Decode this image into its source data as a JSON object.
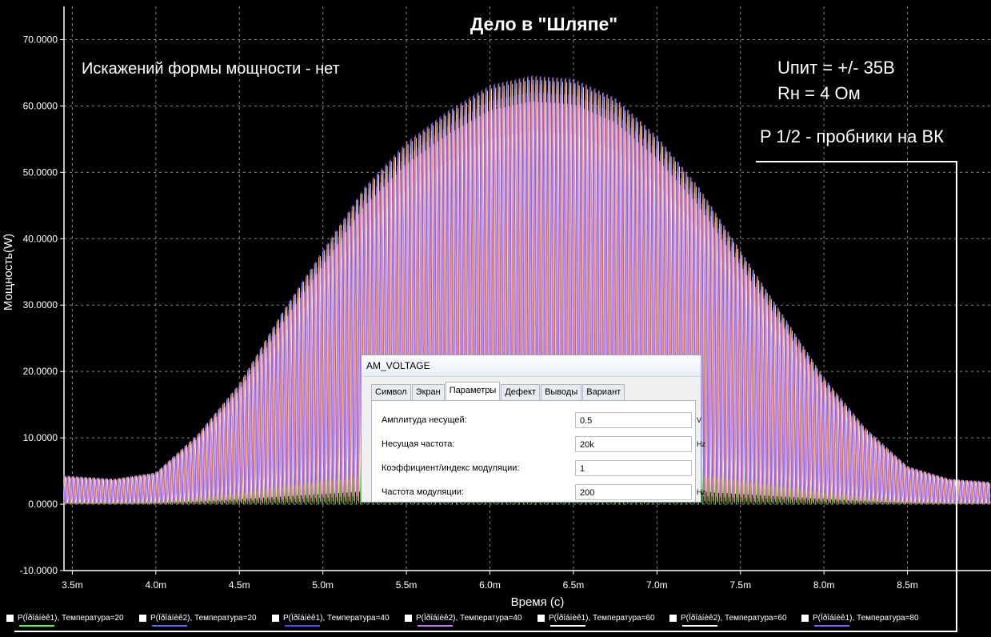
{
  "chart_data": {
    "type": "line",
    "title": "Дело  в  \"Шляпе\"",
    "xlabel": "Время (с)",
    "ylabel": "Мощность(W)",
    "x_unit": "ms",
    "xlim": [
      3.45,
      9.0
    ],
    "ylim": [
      -10,
      75
    ],
    "x_ticks": [
      3.5,
      4.0,
      4.5,
      5.0,
      5.5,
      6.0,
      6.5,
      7.0,
      7.5,
      8.0,
      8.5
    ],
    "x_tick_labels": [
      "3.5m",
      "4.0m",
      "4.5m",
      "5.0m",
      "5.5m",
      "6.0m",
      "6.5m",
      "7.0m",
      "7.5m",
      "8.0m",
      "8.5m"
    ],
    "y_ticks": [
      -10,
      0,
      10,
      20,
      30,
      40,
      50,
      60,
      70
    ],
    "y_tick_labels": [
      "-10.0000",
      "0.0000",
      "10.0000",
      "20.0000",
      "30.0000",
      "40.0000",
      "50.0000",
      "60.0000",
      "70.0000"
    ],
    "grid": true,
    "envelope": {
      "x": [
        3.45,
        3.75,
        4.0,
        4.25,
        4.5,
        4.75,
        5.0,
        5.25,
        5.5,
        5.75,
        6.0,
        6.25,
        6.5,
        6.75,
        7.0,
        7.25,
        7.5,
        7.75,
        8.0,
        8.25,
        8.5,
        8.75,
        9.0
      ],
      "y": [
        4.5,
        4.0,
        5.0,
        11.0,
        19.0,
        30.0,
        40.0,
        50.0,
        57.0,
        62.0,
        66.0,
        67.5,
        67.0,
        64.0,
        58.0,
        50.0,
        40.0,
        30.0,
        20.0,
        12.0,
        6.0,
        4.0,
        3.5
      ]
    },
    "series_colors": [
      "#4cff4c",
      "#5a6bff",
      "#ff9a9a",
      "#d070ff",
      "#ffffff",
      "#ffa060",
      "#8a5cff"
    ]
  },
  "annotations": {
    "no_distortion": "Искажений формы мощности - нет",
    "supply": "Uпит = +/- 35В",
    "load": "Rн = 4 Ом",
    "probes": "P 1/2 - пробники на ВК"
  },
  "legend": [
    {
      "label": "P(Ïðîáíèê1), Температура=20",
      "color": "#4cff4c"
    },
    {
      "label": "P(Ïðîáíèê2), Температура=20",
      "color": "#5a6bff"
    },
    {
      "label": "P(Ïðîáíèê1), Температура=40",
      "color": "#5050ff"
    },
    {
      "label": "P(Ïðîáíèê2), Температура=40",
      "color": "#d070ff"
    },
    {
      "label": "P(Ïðîáíèê1), Температура=60",
      "color": "#ffffff"
    },
    {
      "label": "P(Ïðîáíèê2), Температура=60",
      "color": "#ffffff"
    },
    {
      "label": "P(Ïðîáíèê1), Температура=80",
      "color": "#8a5cff"
    }
  ],
  "dialog": {
    "title": "AM_VOLTAGE",
    "tabs": [
      "Символ",
      "Экран",
      "Параметры",
      "Дефект",
      "Выводы",
      "Вариант"
    ],
    "active_tab": "Параметры",
    "params": [
      {
        "label": "Амплитуда несущей:",
        "value": "0.5",
        "unit": "V"
      },
      {
        "label": "Несущая частота:",
        "value": "20k",
        "unit": "Hz"
      },
      {
        "label": "Коэффициент/индекс модуляции:",
        "value": "1",
        "unit": ""
      },
      {
        "label": "Частота модуляции:",
        "value": "200",
        "unit": "Hz"
      }
    ]
  }
}
